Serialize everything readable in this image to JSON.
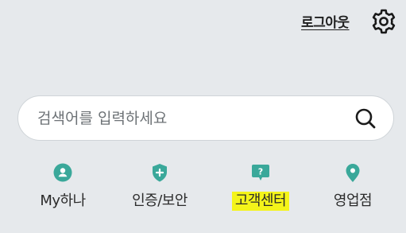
{
  "header": {
    "logout_label": "로그아웃",
    "settings_icon": "gear-icon"
  },
  "search": {
    "placeholder": "검색어를 입력하세요",
    "value": "",
    "icon": "search-icon"
  },
  "menu": {
    "items": [
      {
        "label": "My하나",
        "icon": "user-icon",
        "icon_color": "#3aa89a"
      },
      {
        "label": "인증/보안",
        "icon": "shield-plus-icon",
        "icon_color": "#3aa89a"
      },
      {
        "label": "고객센터",
        "icon": "help-chat-icon",
        "icon_color": "#3aa89a",
        "highlighted": true
      },
      {
        "label": "영업점",
        "icon": "location-pin-icon",
        "icon_color": "#3aa89a"
      }
    ]
  },
  "colors": {
    "background": "#e6e9ec",
    "accent": "#3aa89a",
    "highlight": "#f4f41a"
  }
}
